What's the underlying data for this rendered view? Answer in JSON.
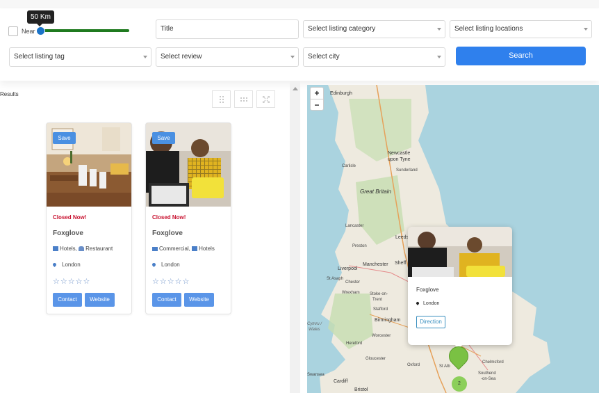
{
  "filters": {
    "near_label": "Near",
    "distance_label": "50 Km",
    "title_value": "Title",
    "category_placeholder": "Select listing category",
    "locations_placeholder": "Select listing locations",
    "tag_placeholder": "Select listing tag",
    "review_placeholder": "Select review",
    "city_placeholder": "Select city",
    "search_label": "Search"
  },
  "results": {
    "label": "Results",
    "cards": [
      {
        "save_label": "Save",
        "status": "Closed Now!",
        "title": "Foxglove",
        "categories": [
          "Hotels,",
          "Restaurant"
        ],
        "location": "London",
        "contact_label": "Contact",
        "website_label": "Website"
      },
      {
        "save_label": "Save",
        "status": "Closed Now!",
        "title": "Foxglove",
        "categories": [
          "Commercial,",
          "Hotels"
        ],
        "location": "London",
        "contact_label": "Contact",
        "website_label": "Website"
      }
    ]
  },
  "map": {
    "zoom_in": "+",
    "zoom_out": "−",
    "popup": {
      "title": "Foxglove",
      "location": "London",
      "direction_label": "Direction"
    },
    "cluster_count": "2",
    "places": [
      "Edinburgh",
      "Newcastle upon Tyne",
      "Carlisle",
      "Sunderland",
      "Great Britain",
      "Lancaster",
      "Leeds",
      "Preston",
      "Manchester",
      "Sheff",
      "Liverpool",
      "St Asaph",
      "Chester",
      "Wrexham",
      "Stoke-on-Trent",
      "Stafford",
      "Cymru / Wales",
      "Birmingham",
      "Worcester",
      "Hereford",
      "Gloucester",
      "Oxford",
      "Swansea",
      "Cardiff",
      "Bristol",
      "St Alb",
      "Southend-on-Sea",
      "Chelmsford"
    ]
  },
  "colors": {
    "accent": "#2f80ed",
    "slider": "#1f7a1f",
    "closed": "#c8102e",
    "marker": "#7ac143"
  }
}
